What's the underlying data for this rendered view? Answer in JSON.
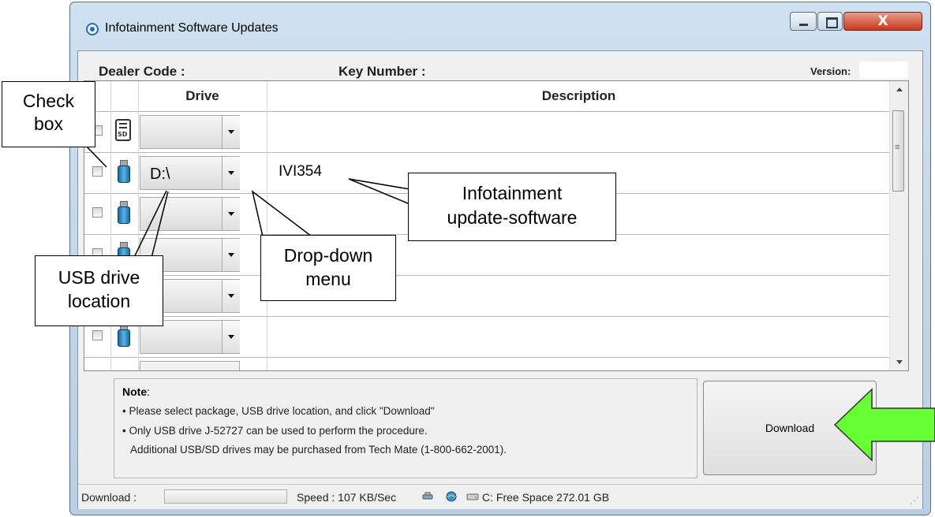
{
  "window": {
    "title": "Infotainment Software Updates",
    "close_glyph": "X"
  },
  "header": {
    "dealer_label": "Dealer Code :",
    "key_label": "Key Number :",
    "version_label": "Version:"
  },
  "grid": {
    "columns": [
      "",
      "",
      "Drive",
      "Description"
    ],
    "rows": [
      {
        "icon": "sd-card-icon",
        "icon_text": "SD",
        "drive": "",
        "description": ""
      },
      {
        "icon": "usb-drive-icon",
        "drive": "D:\\",
        "description": "IVI354"
      },
      {
        "icon": "usb-drive-icon",
        "drive": "",
        "description": ""
      },
      {
        "icon": "usb-drive-icon",
        "drive": "",
        "description": ""
      },
      {
        "icon": "usb-drive-icon",
        "drive": "",
        "description": ""
      },
      {
        "icon": "usb-drive-icon",
        "drive": "",
        "description": ""
      }
    ]
  },
  "note": {
    "title": "Note",
    "title_suffix": ":",
    "lines": [
      "• Please select package, USB drive location, and click \"Download\"",
      "• Only USB drive J-52727 can be used to perform the procedure.",
      "Additional USB/SD drives may be purchased from Tech Mate (1-800-662-2001)."
    ]
  },
  "download_button": "Download",
  "status": {
    "download_label": "Download :",
    "speed": "Speed : 107 KB/Sec",
    "free_space": "C: Free Space 272.01 GB"
  },
  "callouts": {
    "check_box": [
      "Check",
      "box"
    ],
    "usb_location": [
      "USB drive",
      "location"
    ],
    "dropdown": [
      "Drop-down",
      "menu"
    ],
    "infotainment": [
      "Infotainment",
      "update-software"
    ]
  },
  "colors": {
    "arrow": "#66ff33",
    "close_button": "#c53a1f",
    "window_frame": "#b9cfe4"
  }
}
